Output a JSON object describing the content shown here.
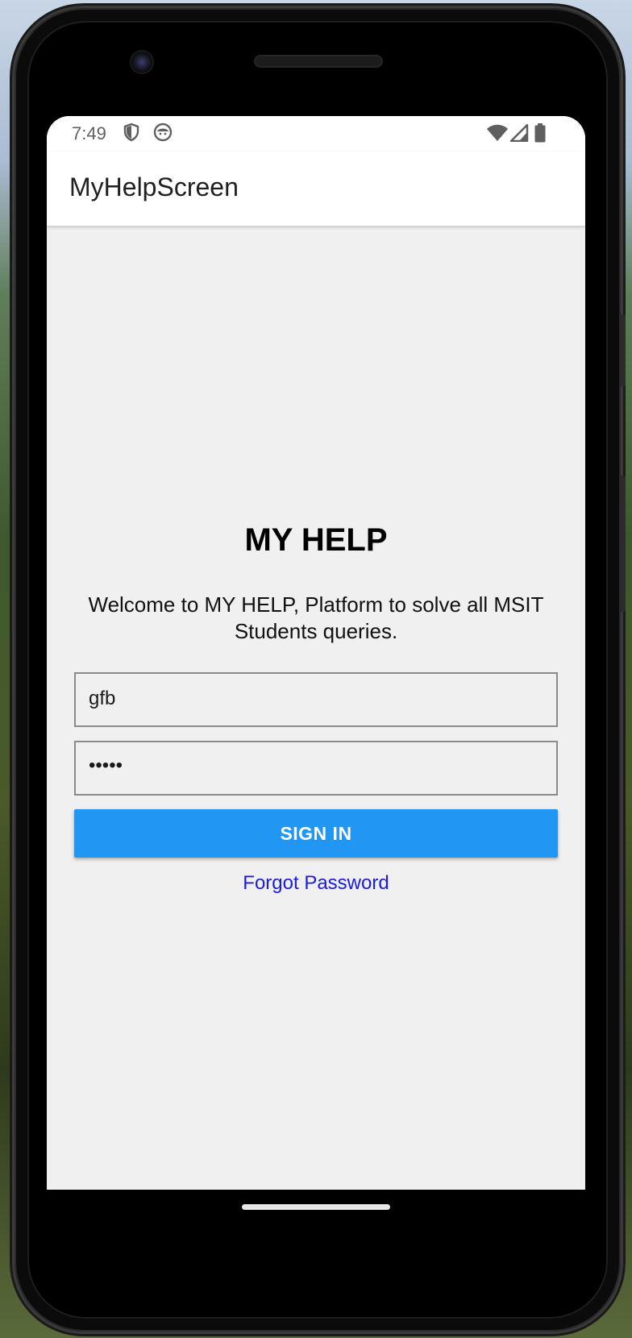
{
  "status_bar": {
    "time": "7:49",
    "left_icons": [
      "shield-icon",
      "android-robot-icon"
    ],
    "right_icons": [
      "wifi-icon",
      "signal-icon",
      "battery-icon"
    ]
  },
  "app_bar": {
    "title": "MyHelpScreen"
  },
  "main": {
    "heading": "MY HELP",
    "welcome_text": "Welcome to MY HELP, Platform to solve all MSIT Students queries.",
    "username_value": "gfb",
    "password_value": "•••••",
    "sign_in_label": "SIGN IN",
    "forgot_password_label": "Forgot Password"
  },
  "colors": {
    "screen_background": "#f0f0f0",
    "app_bar_background": "#ffffff",
    "button_blue": "#2196f3",
    "link_blue": "#1a1ae0"
  }
}
